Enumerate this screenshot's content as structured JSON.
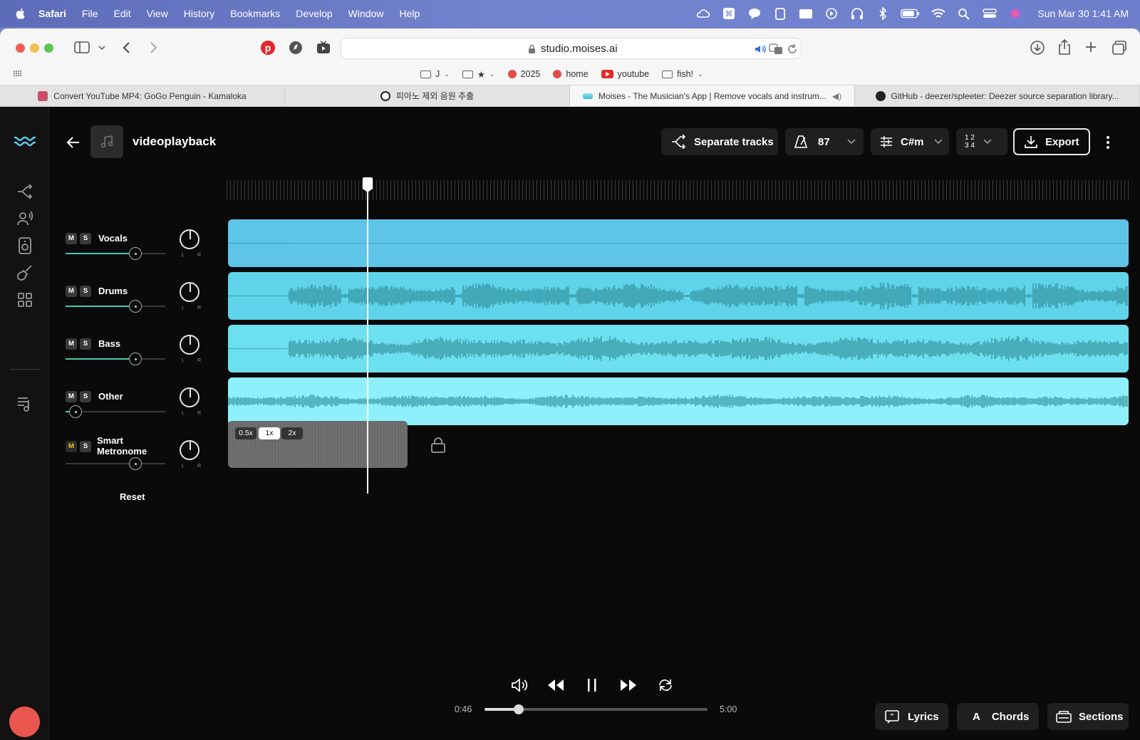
{
  "menubar": {
    "app": "Safari",
    "items": [
      "File",
      "Edit",
      "View",
      "History",
      "Bookmarks",
      "Develop",
      "Window",
      "Help"
    ],
    "clock": "Sun Mar 30  1:41 AM"
  },
  "browser": {
    "url": "studio.moises.ai",
    "bookmarks": [
      {
        "label": "J",
        "icon": "folder-icon"
      },
      {
        "label": "★",
        "icon": "folder-icon"
      },
      {
        "label": "2025",
        "icon": "red-dot-icon"
      },
      {
        "label": "home",
        "icon": "red-dot-icon"
      },
      {
        "label": "youtube",
        "icon": "youtube-icon"
      },
      {
        "label": "fish!",
        "icon": "folder-icon"
      }
    ],
    "tabs": [
      {
        "label": "Convert YouTube MP4: GoGo Penguin - Kamaloka",
        "active": false
      },
      {
        "label": "피아노 제외 음원 추출",
        "active": false
      },
      {
        "label": "Moises - The Musician's App | Remove vocals and instrum...",
        "active": true
      },
      {
        "label": "GitHub - deezer/spleeter: Deezer source separation library...",
        "active": false
      }
    ]
  },
  "song": {
    "title": "videoplayback"
  },
  "header": {
    "separate_label": "Separate tracks",
    "bpm": "87",
    "key": "C#m",
    "time_sig_top": "1 2",
    "time_sig_bottom": "3 4",
    "export_label": "Export"
  },
  "tracks": [
    {
      "name": "Vocals",
      "volume": 0.7,
      "color": "#5ec5e8",
      "wave": "#3a8fa8",
      "amp": 0.0
    },
    {
      "name": "Drums",
      "volume": 0.7,
      "color": "#5fd3e9",
      "wave": "#2f8d98",
      "amp": 0.6
    },
    {
      "name": "Bass",
      "volume": 0.7,
      "color": "#6de0ef",
      "wave": "#2f8d98",
      "amp": 0.55
    },
    {
      "name": "Other",
      "volume": 0.1,
      "color": "#8ef0fb",
      "wave": "#2f8d98",
      "amp": 0.3
    }
  ],
  "metronome": {
    "name": "Smart Metronome",
    "volume": 0.7,
    "speeds": [
      "0.5x",
      "1x",
      "2x"
    ],
    "selected_speed": "1x"
  },
  "mixer": {
    "reset_label": "Reset",
    "pan_left": "L",
    "pan_right": "R",
    "mute": "M",
    "solo": "S"
  },
  "player": {
    "current_time": "0:46",
    "total_time": "5:00",
    "progress": 0.153
  },
  "features": {
    "lyrics": "Lyrics",
    "chords": "Chords",
    "sections": "Sections"
  },
  "colors": {
    "accent": "#3ec9b5",
    "record": "#e9574f"
  }
}
